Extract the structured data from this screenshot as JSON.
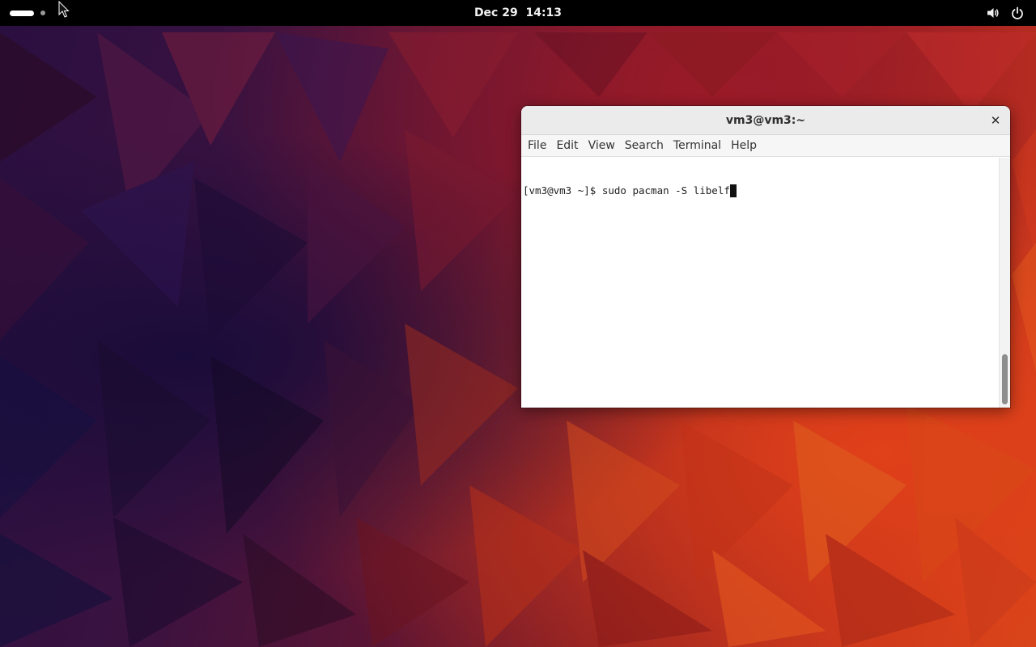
{
  "topbar": {
    "date": "Dec 29",
    "time": "14:13",
    "tray_icons": [
      "volume-icon",
      "power-icon"
    ]
  },
  "terminal": {
    "title": "vm3@vm3:~",
    "close_glyph": "✕",
    "menu": [
      "File",
      "Edit",
      "View",
      "Search",
      "Terminal",
      "Help"
    ],
    "prompt": "[vm3@vm3 ~]$ ",
    "command": "sudo pacman -S libelf"
  },
  "colors": {
    "topbar_bg": "#000000",
    "titlebar_bg": "#ebebeb",
    "terminal_bg": "#ffffff",
    "terminal_fg": "#1e1e1e"
  }
}
